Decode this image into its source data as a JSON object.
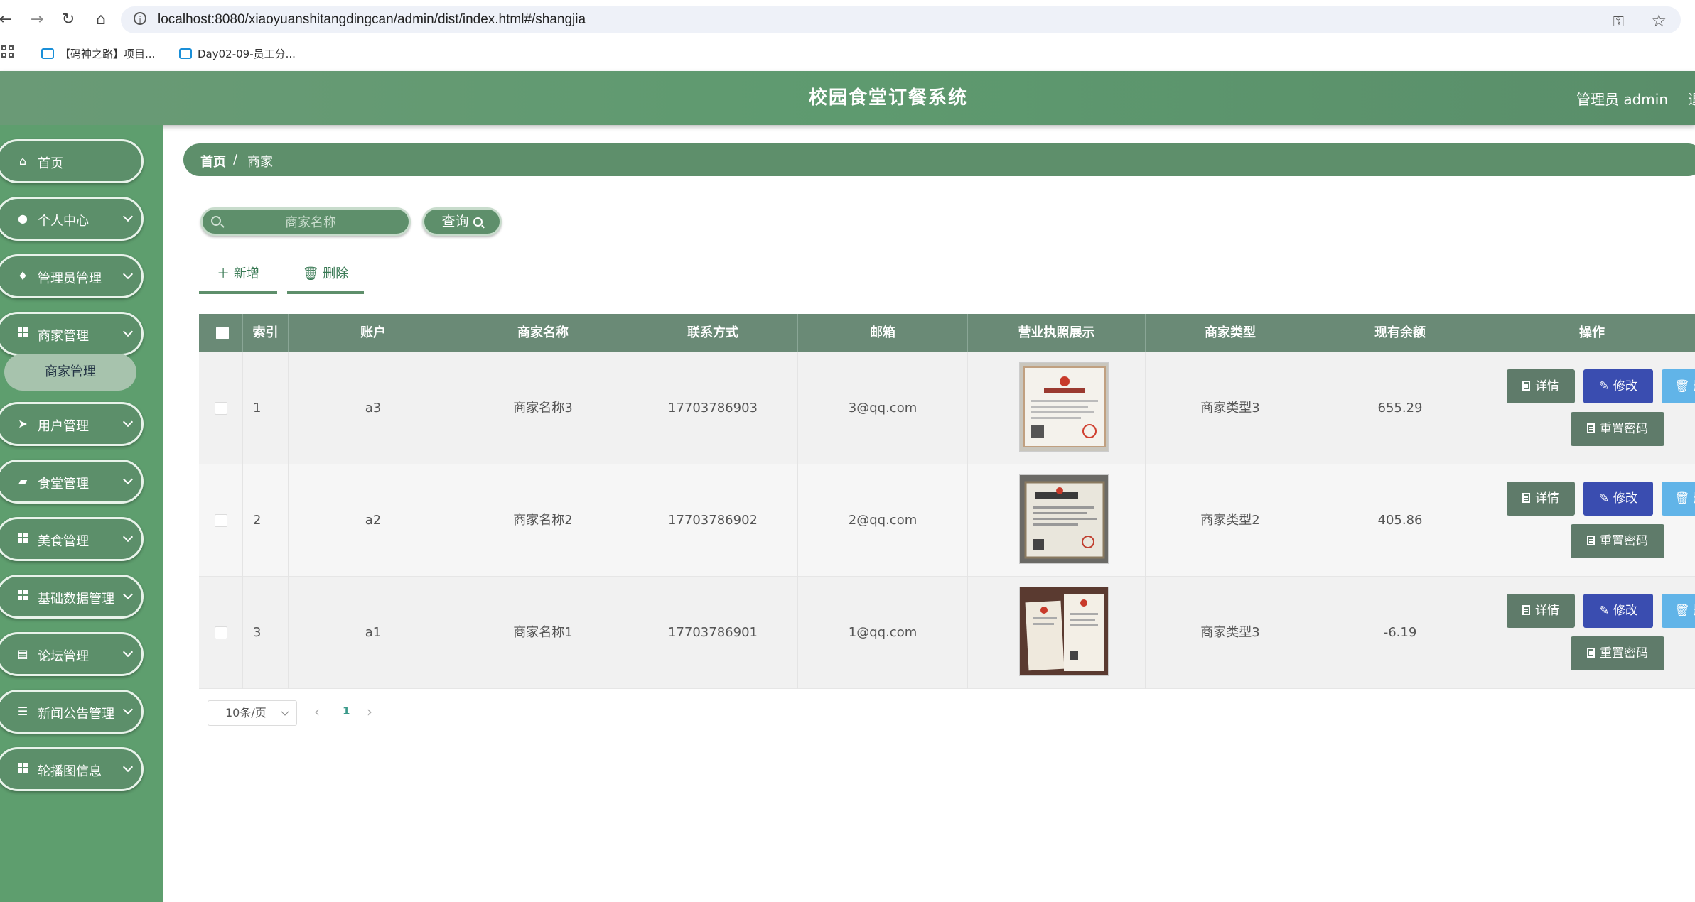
{
  "browser": {
    "url": "localhost:8080/xiaoyuanshitangdingcan/admin/dist/index.html#/shangjia",
    "bookmarks": [
      "【码神之路】项目...",
      "Day02-09-员工分..."
    ]
  },
  "header": {
    "title": "校园食堂订餐系统",
    "admin": "管理员 admin",
    "exit": "退"
  },
  "sidebar": {
    "items": [
      {
        "label": "首页",
        "icon": "home-icon"
      },
      {
        "label": "个人中心",
        "icon": "user-icon"
      },
      {
        "label": "管理员管理",
        "icon": "pin-icon"
      },
      {
        "label": "商家管理",
        "icon": "grid-icon"
      },
      {
        "label": "用户管理",
        "icon": "send-icon"
      },
      {
        "label": "食堂管理",
        "icon": "briefcase-icon"
      },
      {
        "label": "美食管理",
        "icon": "grid-icon"
      },
      {
        "label": "基础数据管理",
        "icon": "grid-icon"
      },
      {
        "label": "论坛管理",
        "icon": "clipboard-icon"
      },
      {
        "label": "新闻公告管理",
        "icon": "sliders-icon"
      },
      {
        "label": "轮播图信息",
        "icon": "grid-icon"
      }
    ],
    "active_sub": "商家管理"
  },
  "breadcrumb": {
    "home": "首页",
    "separator": "/",
    "current": "商家"
  },
  "search": {
    "placeholder": "商家名称",
    "button": "查询"
  },
  "actions": {
    "add": "新增",
    "delete": "删除"
  },
  "table": {
    "columns": [
      "索引",
      "账户",
      "商家名称",
      "联系方式",
      "邮箱",
      "营业执照展示",
      "商家类型",
      "现有余额",
      "操作"
    ],
    "rows": [
      {
        "index": "1",
        "account": "a3",
        "name": "商家名称3",
        "phone": "17703786903",
        "email": "3@qq.com",
        "type": "商家类型3",
        "balance": "655.29"
      },
      {
        "index": "2",
        "account": "a2",
        "name": "商家名称2",
        "phone": "17703786902",
        "email": "2@qq.com",
        "type": "商家类型2",
        "balance": "405.86"
      },
      {
        "index": "3",
        "account": "a1",
        "name": "商家名称1",
        "phone": "17703786901",
        "email": "1@qq.com",
        "type": "商家类型3",
        "balance": "-6.19"
      }
    ],
    "ops": {
      "detail": "详情",
      "edit": "修改",
      "delete": "删",
      "reset": "重置密码"
    }
  },
  "pagination": {
    "page_size": "10条/页",
    "current_page": "1"
  },
  "colors": {
    "header": "#5e9a6f",
    "sidebar": "#5e9e6e",
    "primary": "#5e8f6b",
    "edit": "#3a4db0",
    "delete": "#61b4e8"
  }
}
